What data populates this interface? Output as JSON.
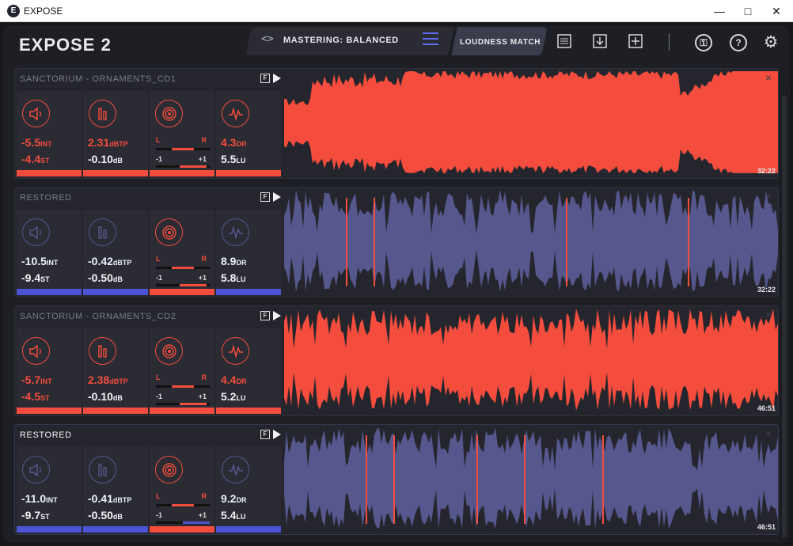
{
  "window": {
    "title": "EXPOSE"
  },
  "header": {
    "app_name": "EXPOSE 2",
    "preset_code_icon": "code-icon",
    "preset_label": "MASTERING: BALANCED",
    "loudness_match_label": "LOUDNESS MATCH",
    "tools": [
      "notes-icon",
      "export-icon",
      "add-icon",
      "key-icon",
      "help-icon",
      "settings-icon"
    ]
  },
  "colors": {
    "red": "#f44d3d",
    "blue": "#55578d",
    "blue_bar": "#4c54d3"
  },
  "tracks": [
    {
      "name": "SANCTORIUM - ORNAMENTS_CD1",
      "style": "red",
      "int": "-5.5",
      "st": "-4.4",
      "dbtp": "2.31",
      "db": "-0.10",
      "dr": "4.3",
      "lu": "5.5",
      "time": "32:22",
      "l": "L",
      "r": "R",
      "m": "-1",
      "p": "+1"
    },
    {
      "name": "RESTORED",
      "style": "blue",
      "int": "-10.5",
      "st": "-9.4",
      "dbtp": "-0.42",
      "db": "-0.50",
      "dr": "8.9",
      "lu": "5.8",
      "time": "32:22",
      "l": "L",
      "r": "R",
      "m": "-1",
      "p": "+1"
    },
    {
      "name": "SANCTORIUM - ORNAMENTS_CD2",
      "style": "red",
      "int": "-5.7",
      "st": "-4.5",
      "dbtp": "2.38",
      "db": "-0.10",
      "dr": "4.4",
      "lu": "5.2",
      "time": "46:51",
      "l": "L",
      "r": "R",
      "m": "-1",
      "p": "+1"
    },
    {
      "name": "RESTORED",
      "style": "blue",
      "int": "-11.0",
      "st": "-9.7",
      "dbtp": "-0.41",
      "db": "-0.50",
      "dr": "9.2",
      "lu": "5.4",
      "time": "46:51",
      "l": "L",
      "r": "R",
      "m": "-1",
      "p": "+1"
    }
  ],
  "units": {
    "int": "INT",
    "st": "ST",
    "dbtp": "dBTP",
    "db": "dB",
    "dr": "DR",
    "lu": "LU"
  }
}
